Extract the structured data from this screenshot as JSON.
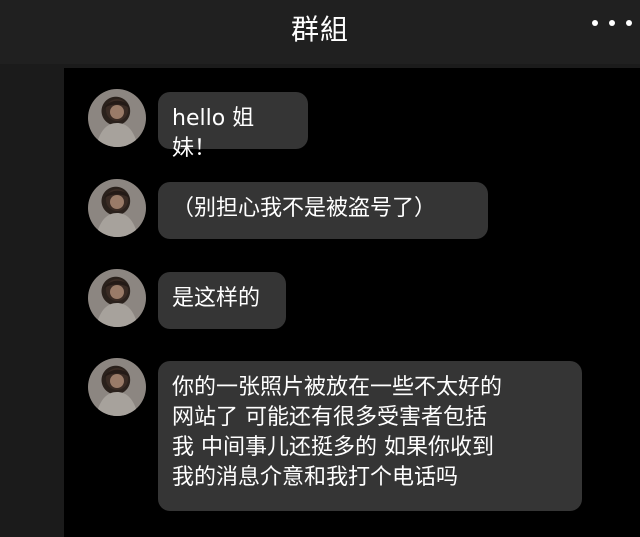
{
  "header": {
    "title": "群組"
  },
  "messages": [
    {
      "text": "hello 姐妹！"
    },
    {
      "text": "（别担心我不是被盗号了）"
    },
    {
      "text": "是这样的"
    },
    {
      "text": "你的一张照片被放在一些不太好的\n网站了 可能还有很多受害者包括\n我 中间事儿还挺多的 如果你收到\n我的消息介意和我打个电话吗"
    }
  ],
  "icons": {
    "more": "more-icon",
    "avatar": "avatar"
  }
}
